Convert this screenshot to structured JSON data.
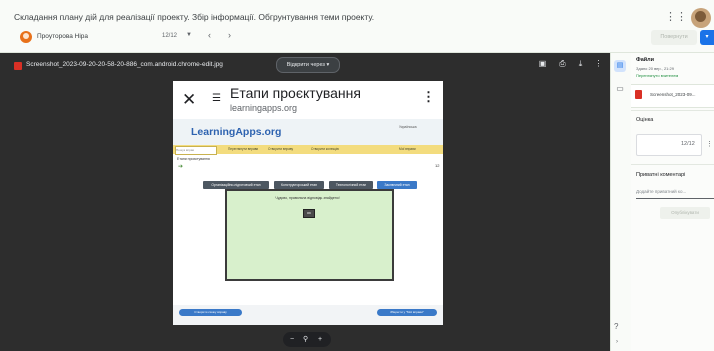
{
  "header": {
    "title": "Складання плану дій для реалізації проекту. Збір інформації. Обгрунтування теми проекту.",
    "student_name": "Проуторова Ніра",
    "grade_display": "12/12",
    "return_label": "Повернути"
  },
  "viewer": {
    "filename": "Screenshot_2023-09-20-20-58-20-886_com.android.chrome-edit.jpg",
    "open_with_label": "Відкрити через"
  },
  "screenshot": {
    "page_title": "Етапи проєктування",
    "url": "learningapps.org",
    "logo": "LearningApps.org",
    "language": "Українська",
    "search_placeholder": "Пошук вправ",
    "nav_items": [
      "Переглянути вправи",
      "Створити вправу",
      "Створити колекцію",
      "Мої вправи"
    ],
    "breadcrumb": "Етапи проєктування",
    "tabs": [
      "Організаційно-підготовчий етап",
      "Конструкторський етап",
      "Технологічний етап",
      "Заключний етап"
    ],
    "correct_message": "Чудово, правильна відповідь знайдено!",
    "ok_label": "OK",
    "counter": "12",
    "bottom_left": "Створити схожу вправу",
    "bottom_right": "Зберегти у \"Мої вправи\""
  },
  "panel": {
    "files_title": "Файли",
    "files_date": "Здано 20 вер., 21:29",
    "files_status": "Переглянуто вчителем",
    "file_name": "Screenshot_2023-09...",
    "grade_title": "Оцінка",
    "grade_value": "12/12",
    "private_comments_title": "Приватні коментарі",
    "private_comments_placeholder": "Додайте приватний ко...",
    "post_label": "Опублікувати"
  },
  "colors": {
    "accent": "#1a73e8",
    "viewer_bg": "#2d2d2d",
    "file_red": "#d93025"
  }
}
